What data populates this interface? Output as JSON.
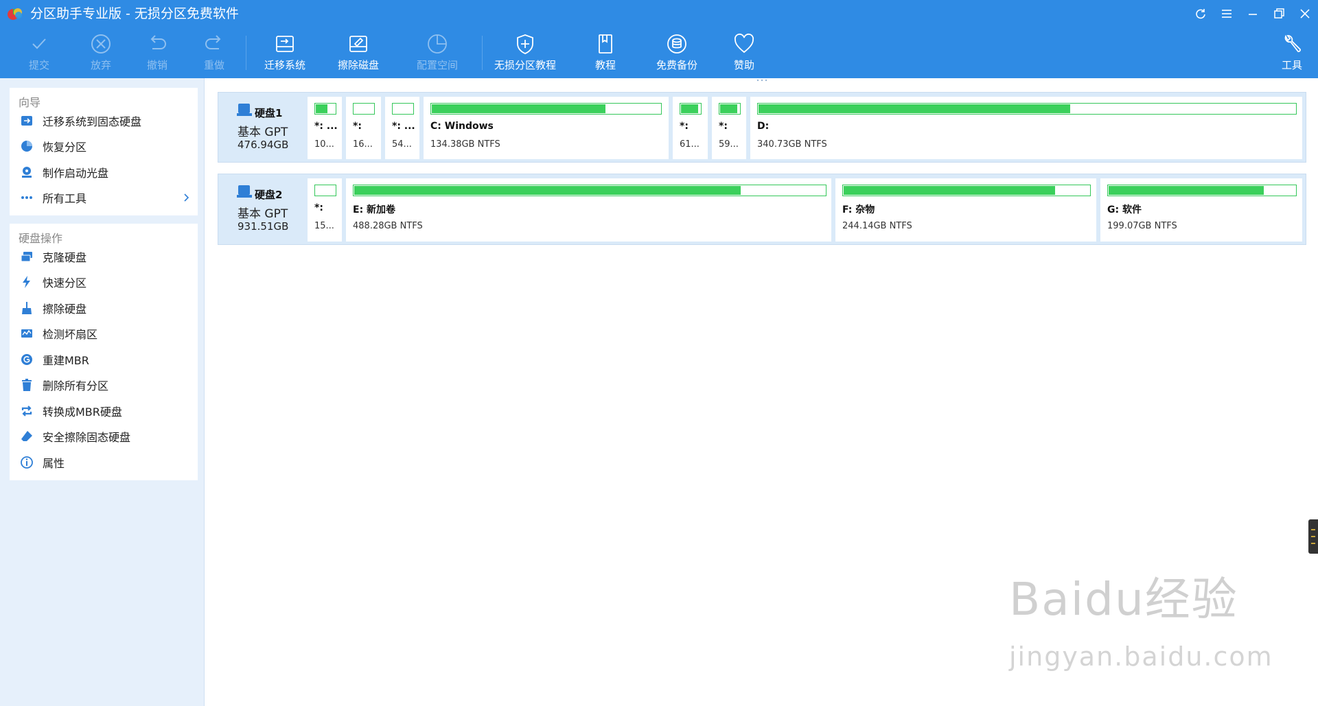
{
  "window": {
    "title": "分区助手专业版 - 无损分区免费软件",
    "controls": [
      "refresh-icon",
      "menu-icon",
      "minimize-icon",
      "restore-icon",
      "close-icon"
    ]
  },
  "toolbar": {
    "buttons": [
      {
        "label": "提交",
        "icon": "check-icon",
        "enabled": false
      },
      {
        "label": "放弃",
        "icon": "cancel-circle-icon",
        "enabled": false
      },
      {
        "label": "撤销",
        "icon": "undo-icon",
        "enabled": false
      },
      {
        "label": "重做",
        "icon": "redo-icon",
        "enabled": false
      },
      {
        "label": "迁移系统",
        "icon": "migrate-disk-icon",
        "enabled": true
      },
      {
        "label": "擦除磁盘",
        "icon": "wipe-disk-icon",
        "enabled": true
      },
      {
        "label": "配置空间",
        "icon": "pie-chart-icon",
        "enabled": false
      },
      {
        "label": "无损分区教程",
        "icon": "shield-plus-icon",
        "enabled": true
      },
      {
        "label": "教程",
        "icon": "book-icon",
        "enabled": true
      },
      {
        "label": "免费备份",
        "icon": "backup-icon",
        "enabled": true
      },
      {
        "label": "赞助",
        "icon": "heart-icon",
        "enabled": true
      },
      {
        "label": "工具",
        "icon": "wrench-icon",
        "enabled": true
      }
    ]
  },
  "sidebar": {
    "wizard": {
      "title": "向导",
      "items": [
        {
          "label": "迁移系统到固态硬盘",
          "icon": "migrate-ssd-icon"
        },
        {
          "label": "恢复分区",
          "icon": "recover-partition-icon"
        },
        {
          "label": "制作启动光盘",
          "icon": "boot-disc-icon"
        },
        {
          "label": "所有工具",
          "icon": "more-dots-icon"
        }
      ]
    },
    "disk_ops": {
      "title": "硬盘操作",
      "items": [
        {
          "label": "克隆硬盘",
          "icon": "clone-disk-icon"
        },
        {
          "label": "快速分区",
          "icon": "lightning-icon"
        },
        {
          "label": "擦除硬盘",
          "icon": "broom-icon"
        },
        {
          "label": "检测坏扇区",
          "icon": "scan-sector-icon"
        },
        {
          "label": "重建MBR",
          "icon": "rebuild-mbr-icon"
        },
        {
          "label": "删除所有分区",
          "icon": "trash-icon"
        },
        {
          "label": "转换成MBR硬盘",
          "icon": "convert-icon"
        },
        {
          "label": "安全擦除固态硬盘",
          "icon": "eraser-icon"
        },
        {
          "label": "属性",
          "icon": "info-icon"
        }
      ]
    }
  },
  "disks": [
    {
      "name": "硬盘1",
      "type": "基本 GPT",
      "size": "476.94GB",
      "partitions": [
        {
          "name": "*: ...",
          "desc": "10...",
          "used": 0.6
        },
        {
          "name": "*:",
          "desc": "16...",
          "used": 0.0
        },
        {
          "name": "*: ...",
          "desc": "54...",
          "used": 0.0
        },
        {
          "name": "C: Windows",
          "desc": "134.38GB NTFS",
          "used": 0.76
        },
        {
          "name": "*:",
          "desc": "61...",
          "used": 0.9
        },
        {
          "name": "*:",
          "desc": "59...",
          "used": 0.9
        },
        {
          "name": "D:",
          "desc": "340.73GB NTFS",
          "used": 0.58
        }
      ]
    },
    {
      "name": "硬盘2",
      "type": "基本 GPT",
      "size": "931.51GB",
      "partitions": [
        {
          "name": "*:",
          "desc": "15...",
          "used": 0.0
        },
        {
          "name": "E: 新加卷",
          "desc": "488.28GB NTFS",
          "used": 0.82
        },
        {
          "name": "F: 杂物",
          "desc": "244.14GB NTFS",
          "used": 0.86
        },
        {
          "name": "G: 软件",
          "desc": "199.07GB NTFS",
          "used": 0.83
        }
      ]
    }
  ],
  "watermark": {
    "logo": "Baidu经验",
    "url": "jingyan.baidu.com"
  },
  "colors": {
    "accent": "#2f8be4",
    "partition_fill": "#3bd05b",
    "sidebar_bg": "#e6f0fb",
    "disk_row_bg": "#daeaf9"
  }
}
